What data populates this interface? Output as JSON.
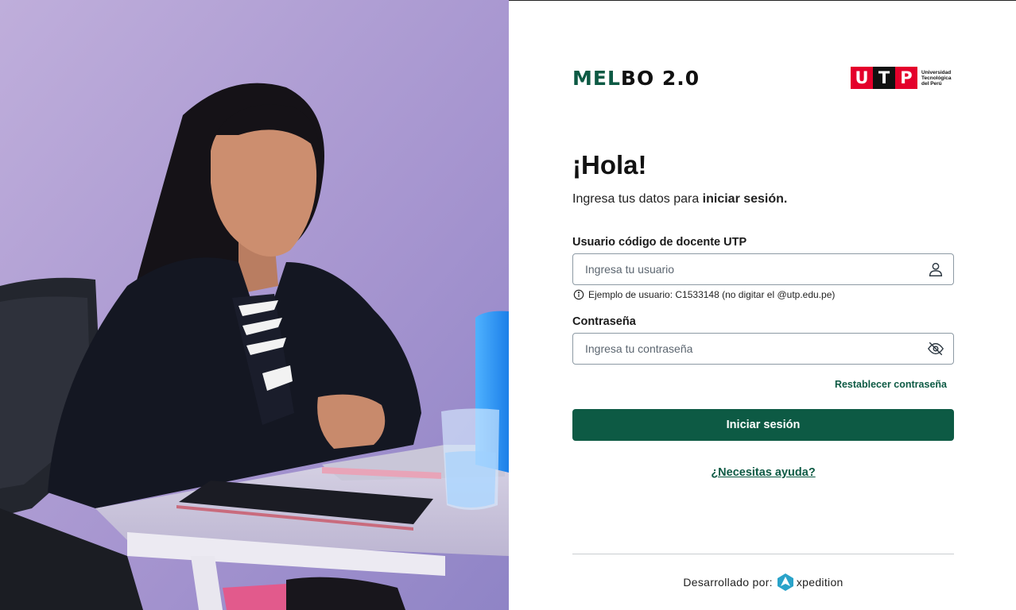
{
  "brand": {
    "name_part1": "MEL",
    "name_part2": "BO 2.0"
  },
  "university": {
    "logo_letters": [
      "U",
      "T",
      "P"
    ],
    "logo_text_lines": [
      "Universidad",
      "Tecnológica",
      "del Perú"
    ]
  },
  "greeting": "¡Hola!",
  "subtitle": {
    "prefix": "Ingresa tus datos para ",
    "emphasis": "iniciar sesión."
  },
  "username_field": {
    "label": "Usuario código de docente UTP",
    "placeholder": "Ingresa tu usuario",
    "icon": "user-icon",
    "hint": "Ejemplo de usuario: C1533148 (no digitar el @utp.edu.pe)"
  },
  "password_field": {
    "label": "Contraseña",
    "placeholder": "Ingresa tu contraseña",
    "icon": "eye-off-icon"
  },
  "reset_link": "Restablecer contraseña",
  "login_button": "Iniciar sesión",
  "help_link": "¿Necesitas ayuda?",
  "footer": {
    "developed_by": "Desarrollado por:",
    "company": "xpedition"
  },
  "colors": {
    "primary": "#0d5a44",
    "utp_red": "#e4002b",
    "text": "#1a1a1a",
    "border": "#8d9aa4"
  }
}
